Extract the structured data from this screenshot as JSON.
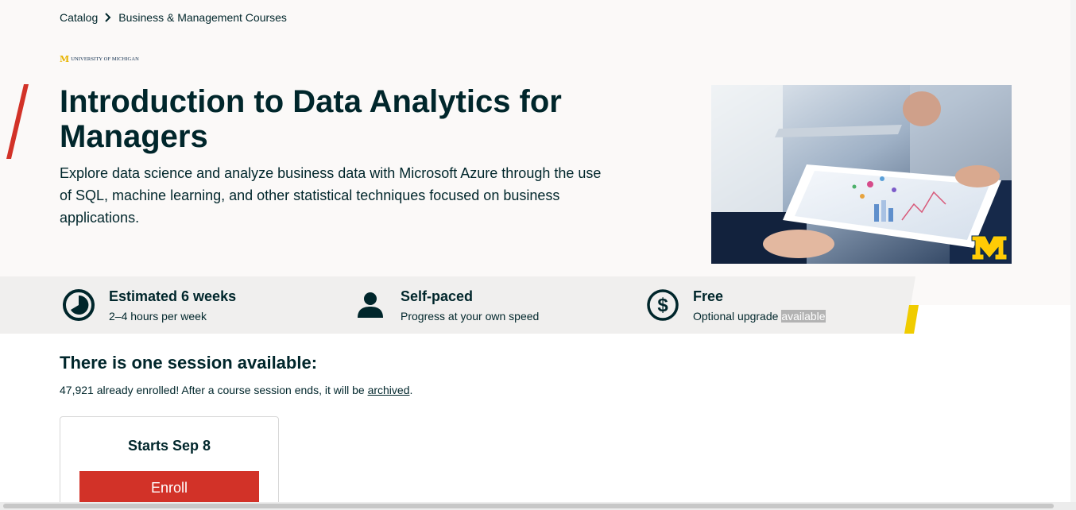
{
  "breadcrumb": {
    "items": [
      "Catalog",
      "Business & Management Courses"
    ]
  },
  "institution": {
    "logo_mark": "M",
    "logo_text": "UNIVERSITY OF MICHIGAN"
  },
  "course": {
    "title": "Introduction to Data Analytics for Managers",
    "description": "Explore data science and analyze business data with Microsoft Azure through the use of SQL, machine learning, and other statistical techniques focused on business applications.",
    "image_icon": "business-tablet-photo"
  },
  "stats": [
    {
      "title": "Estimated 6 weeks",
      "subtitle": "2–4 hours per week",
      "icon": "clock-icon"
    },
    {
      "title": "Self-paced",
      "subtitle": "Progress at your own speed",
      "icon": "person-icon"
    },
    {
      "title": "Free",
      "subtitle_prefix": "Optional upgrade ",
      "subtitle_highlight": "available",
      "icon": "dollar-icon"
    }
  ],
  "session": {
    "heading": "There is one session available:",
    "text_before": "47,921 already enrolled! After a course session ends, it will be ",
    "link": "archived",
    "text_after": ".",
    "card": {
      "starts": "Starts Sep 8",
      "button": "Enroll"
    }
  },
  "colors": {
    "brand_dark": "#00262b",
    "accent_red": "#d23228",
    "accent_yellow": "#f0cc00",
    "michigan_maize": "#ffcb05"
  }
}
